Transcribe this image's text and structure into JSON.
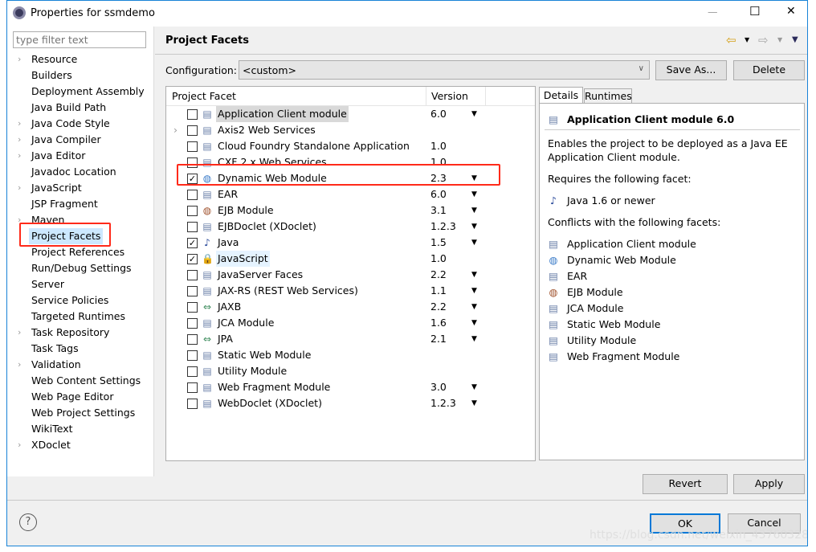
{
  "window": {
    "title": "Properties for ssmdemo",
    "minimize": "—",
    "maximize": "☐",
    "close": "✕"
  },
  "filter": {
    "placeholder": "type filter text"
  },
  "sidebar": {
    "items": [
      {
        "label": "Resource",
        "expandable": true
      },
      {
        "label": "Builders"
      },
      {
        "label": "Deployment Assembly"
      },
      {
        "label": "Java Build Path"
      },
      {
        "label": "Java Code Style",
        "expandable": true
      },
      {
        "label": "Java Compiler",
        "expandable": true
      },
      {
        "label": "Java Editor",
        "expandable": true
      },
      {
        "label": "Javadoc Location"
      },
      {
        "label": "JavaScript",
        "expandable": true
      },
      {
        "label": "JSP Fragment"
      },
      {
        "label": "Maven",
        "expandable": true
      },
      {
        "label": "Project Facets",
        "selected": true
      },
      {
        "label": "Project References"
      },
      {
        "label": "Run/Debug Settings"
      },
      {
        "label": "Server"
      },
      {
        "label": "Service Policies"
      },
      {
        "label": "Targeted Runtimes"
      },
      {
        "label": "Task Repository",
        "expandable": true
      },
      {
        "label": "Task Tags"
      },
      {
        "label": "Validation",
        "expandable": true
      },
      {
        "label": "Web Content Settings"
      },
      {
        "label": "Web Page Editor"
      },
      {
        "label": "Web Project Settings"
      },
      {
        "label": "WikiText"
      },
      {
        "label": "XDoclet",
        "expandable": true
      }
    ]
  },
  "page": {
    "title": "Project Facets",
    "back_icon": "⇦",
    "forward_icon": "⇨",
    "menu_icon": "▼"
  },
  "configuration": {
    "label": "Configuration:",
    "value": "<custom>",
    "save_as": "Save As...",
    "delete": "Delete"
  },
  "facets": {
    "col_facet": "Project Facet",
    "col_version": "Version",
    "rows": [
      {
        "name": "Application Client module",
        "version": "6.0",
        "checked": false,
        "dropdown": true,
        "icon": "page"
      },
      {
        "name": "Axis2 Web Services",
        "version": "",
        "checked": false,
        "expandable": true,
        "icon": "page"
      },
      {
        "name": "Cloud Foundry Standalone Application",
        "version": "1.0",
        "checked": false,
        "icon": "page"
      },
      {
        "name": "CXF 2.x Web Services",
        "version": "1.0",
        "checked": false,
        "icon": "page"
      },
      {
        "name": "Dynamic Web Module",
        "version": "2.3",
        "checked": true,
        "dropdown": true,
        "icon": "globe-jar"
      },
      {
        "name": "EAR",
        "version": "6.0",
        "checked": false,
        "dropdown": true,
        "icon": "page"
      },
      {
        "name": "EJB Module",
        "version": "3.1",
        "checked": false,
        "dropdown": true,
        "icon": "bean-jar"
      },
      {
        "name": "EJBDoclet (XDoclet)",
        "version": "1.2.3",
        "checked": false,
        "dropdown": true,
        "icon": "page"
      },
      {
        "name": "Java",
        "version": "1.5",
        "checked": true,
        "dropdown": true,
        "icon": "java"
      },
      {
        "name": "JavaScript",
        "version": "1.0",
        "checked": true,
        "icon": "lock-page"
      },
      {
        "name": "JavaServer Faces",
        "version": "2.2",
        "checked": false,
        "dropdown": true,
        "icon": "page"
      },
      {
        "name": "JAX-RS (REST Web Services)",
        "version": "1.1",
        "checked": false,
        "dropdown": true,
        "icon": "page"
      },
      {
        "name": "JAXB",
        "version": "2.2",
        "checked": false,
        "dropdown": true,
        "icon": "arrows"
      },
      {
        "name": "JCA Module",
        "version": "1.6",
        "checked": false,
        "dropdown": true,
        "icon": "page"
      },
      {
        "name": "JPA",
        "version": "2.1",
        "checked": false,
        "dropdown": true,
        "icon": "arrows"
      },
      {
        "name": "Static Web Module",
        "version": "",
        "checked": false,
        "icon": "page"
      },
      {
        "name": "Utility Module",
        "version": "",
        "checked": false,
        "icon": "page"
      },
      {
        "name": "Web Fragment Module",
        "version": "3.0",
        "checked": false,
        "dropdown": true,
        "icon": "page"
      },
      {
        "name": "WebDoclet (XDoclet)",
        "version": "1.2.3",
        "checked": false,
        "dropdown": true,
        "icon": "page"
      }
    ]
  },
  "details": {
    "tabs": [
      "Details",
      "Runtimes"
    ],
    "title": "Application Client module 6.0",
    "description": "Enables the project to be deployed as a Java EE Application Client module.",
    "requires_label": "Requires the following facet:",
    "requires": [
      "Java 1.6 or newer"
    ],
    "conflicts_label": "Conflicts with the following facets:",
    "conflicts": [
      "Application Client module",
      "Dynamic Web Module",
      "EAR",
      "EJB Module",
      "JCA Module",
      "Static Web Module",
      "Utility Module",
      "Web Fragment Module"
    ]
  },
  "buttons": {
    "revert": "Revert",
    "apply": "Apply",
    "ok": "OK",
    "cancel": "Cancel",
    "help": "?"
  },
  "watermark": "https://blog.csdn.net/weixin_43760328",
  "colors": {
    "highlight": "#ff2a1a",
    "selection": "#cce8ff",
    "accent": "#0078d7"
  }
}
